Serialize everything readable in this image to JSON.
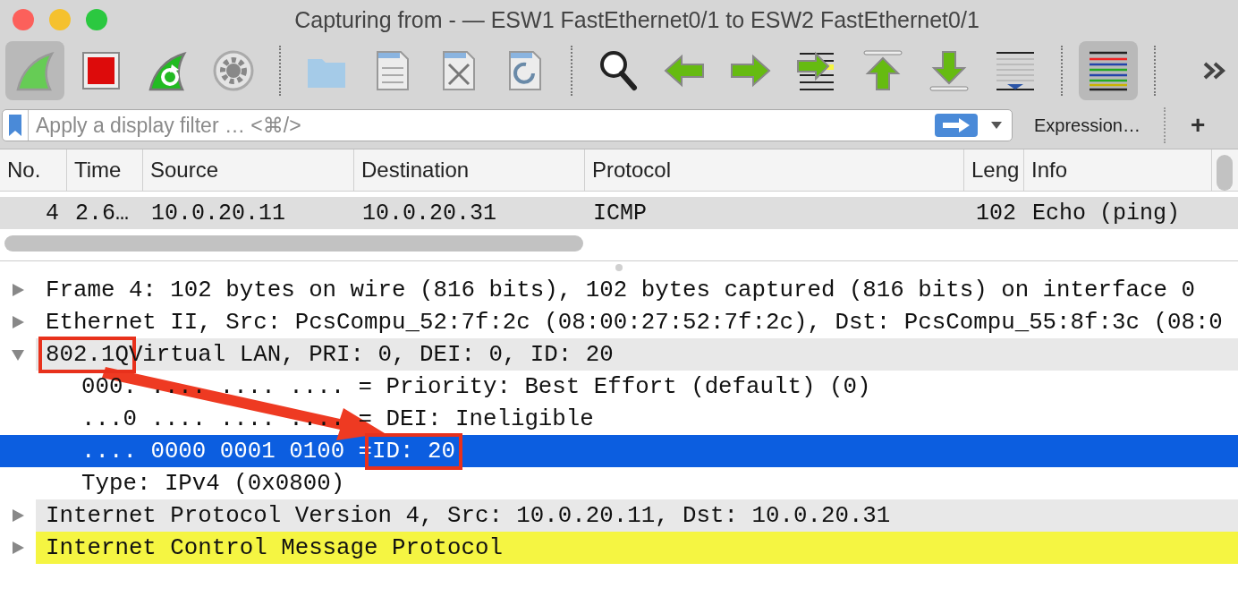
{
  "window": {
    "title": "Capturing from - — ESW1 FastEthernet0/1 to ESW2 FastEthernet0/1"
  },
  "toolbar": {
    "buttons": [
      {
        "pressed": true
      },
      {
        "pressed": false
      },
      {
        "pressed": false
      },
      {
        "pressed": false
      },
      {
        "pressed": false
      },
      {
        "pressed": false
      },
      {
        "pressed": false
      },
      {
        "pressed": false
      },
      {
        "pressed": false
      },
      {
        "pressed": false
      },
      {
        "pressed": false
      },
      {
        "pressed": false
      },
      {
        "pressed": false
      },
      {
        "pressed": false
      },
      {
        "pressed": false
      },
      {
        "pressed": true
      }
    ]
  },
  "filter": {
    "placeholder": "Apply a display filter … <⌘/>",
    "expression_button": "Expression…",
    "add_button": "+"
  },
  "packet_list": {
    "columns": [
      "No.",
      "Time",
      "Source",
      "Destination",
      "Protocol",
      "Leng",
      "Info"
    ],
    "rows": [
      {
        "cells": [
          "4",
          "2.6…",
          "10.0.20.11",
          "10.0.20.31",
          "ICMP",
          "102",
          "Echo (ping)"
        ],
        "selected": true
      }
    ]
  },
  "details": {
    "arrow": true,
    "items": [
      {
        "text": "Frame 4: 102 bytes on wire (816 bits), 102 bytes captured (816 bits) on interface 0",
        "expanded": false,
        "selected": false,
        "color": "#ffffff"
      },
      {
        "text": "Ethernet II, Src: PcsCompu_52:7f:2c (08:00:27:52:7f:2c), Dst: PcsCompu_55:8f:3c (08:0",
        "expanded": false,
        "selected": false,
        "color": "#ffffff"
      },
      {
        "parts": [
          {
            "text": "802.1Q",
            "marked": true
          },
          {
            "text": "Virtual LAN, PRI: 0, DEI: 0, ID: 20",
            "marked": false
          }
        ],
        "expanded": true,
        "selected": false,
        "color": "#e8e8e8",
        "children": [
          {
            "text": "000. .... .... .... = Priority: Best Effort (default) (0)",
            "selected": false
          },
          {
            "text": "...0 .... .... .... = DEI: Ineligible",
            "selected": false
          },
          {
            "parts": [
              {
                "text": ".... 0000 0001 0100 =",
                "marked": false
              },
              {
                "text": "ID: 20",
                "marked": true
              }
            ],
            "selected": true
          },
          {
            "text": "Type: IPv4 (0x0800)",
            "selected": false
          }
        ]
      },
      {
        "text": "Internet Protocol Version 4, Src: 10.0.20.11, Dst: 10.0.20.31",
        "expanded": false,
        "selected": false,
        "color": "#e8e8e8"
      },
      {
        "text": "Internet Control Message Protocol",
        "expanded": false,
        "selected": false,
        "color": "#f5f542"
      }
    ]
  }
}
